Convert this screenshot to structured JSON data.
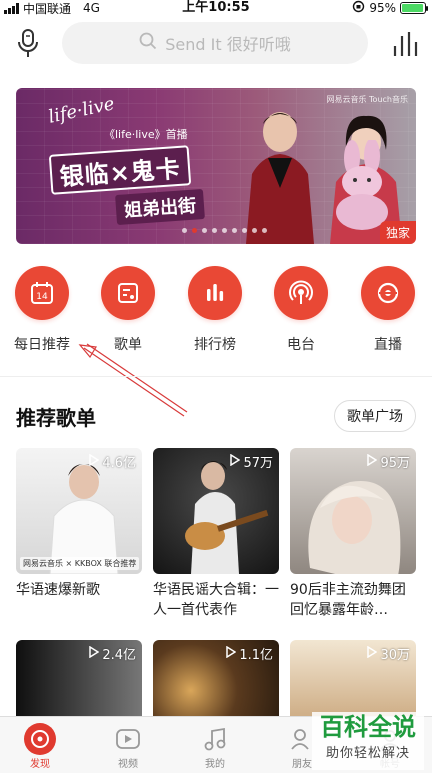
{
  "status_bar": {
    "carrier": "中国联通",
    "network": "4G",
    "time": "上午10:55",
    "battery": "95%",
    "battery_level": 0.95
  },
  "header": {
    "search_placeholder": "Send It 很好听哦",
    "mic_icon": "mic-icon",
    "charts_icon": "bars-icon"
  },
  "banner": {
    "script_text": "life·live",
    "premiere": "《life·live》首播",
    "title": "银临×鬼卡",
    "subtitle": "姐弟出街",
    "brand": "网易云音乐 Touch音乐",
    "badge": "独家",
    "dots": 9,
    "active_dot": 1
  },
  "quick_nav": [
    {
      "label": "每日推荐",
      "icon": "calendar-icon",
      "day": "14"
    },
    {
      "label": "歌单",
      "icon": "playlist-icon"
    },
    {
      "label": "排行榜",
      "icon": "chart-icon"
    },
    {
      "label": "电台",
      "icon": "radio-icon"
    },
    {
      "label": "直播",
      "icon": "live-icon"
    }
  ],
  "section": {
    "title": "推荐歌单",
    "more": "歌单广场"
  },
  "playlists": [
    {
      "plays": "4.6亿",
      "title": "华语速爆新歌",
      "cover_text": "网易云音乐 × KKBOX 联合推荐",
      "color_a": "#f2f2f2",
      "color_b": "#d8d8d8"
    },
    {
      "plays": "57万",
      "title": "华语民谣大合辑：一人一首代表作",
      "color_a": "#2a2a2a",
      "color_b": "#555555"
    },
    {
      "plays": "95万",
      "title": "90后非主流劲舞团回忆暴露年龄…",
      "color_a": "#c9c2bb",
      "color_b": "#8f8780"
    },
    {
      "plays": "2.4亿",
      "title": "",
      "color_a": "#1e1e1e",
      "color_b": "#6a6a6a"
    },
    {
      "plays": "1.1亿",
      "title": "",
      "color_a": "#3a2a1a",
      "color_b": "#c79a52"
    },
    {
      "plays": "30万",
      "title": "",
      "color_a": "#e8d3b0",
      "color_b": "#b98a55"
    }
  ],
  "tabbar": [
    {
      "label": "发现",
      "icon": "disc-icon",
      "active": true
    },
    {
      "label": "视频",
      "icon": "video-icon",
      "active": false
    },
    {
      "label": "我的",
      "icon": "music-note-icon",
      "active": false
    },
    {
      "label": "朋友",
      "icon": "friends-icon",
      "active": false
    },
    {
      "label": "帐号",
      "icon": "account-icon",
      "active": false
    }
  ],
  "watermark": {
    "main": "百科全说",
    "sub": "助你轻松解决"
  },
  "colors": {
    "brand_red": "#e94835",
    "watermark_green": "#1f9b3e"
  }
}
